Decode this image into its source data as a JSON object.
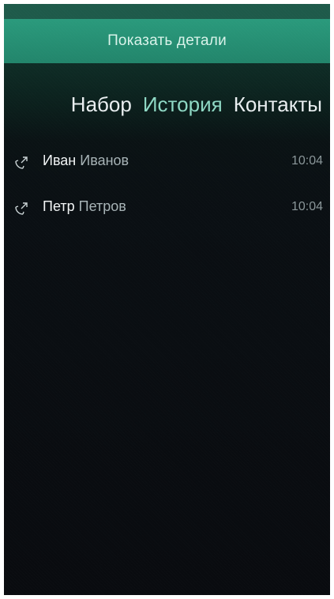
{
  "pulley_menu": {
    "label": "Показать детали"
  },
  "tabs": [
    {
      "label": "Набор",
      "active": false
    },
    {
      "label": "История",
      "active": true
    },
    {
      "label": "Контакты",
      "active": false
    }
  ],
  "calls": [
    {
      "first_name": "Иван",
      "last_name": "Иванов",
      "time": "10:04",
      "icon": "outgoing-call-icon"
    },
    {
      "first_name": "Петр",
      "last_name": "Петров",
      "time": "10:04",
      "icon": "outgoing-call-icon"
    }
  ],
  "colors": {
    "accent": "#2a9a7c",
    "active_tab": "#8ed8c4",
    "background": "#090b0f"
  }
}
